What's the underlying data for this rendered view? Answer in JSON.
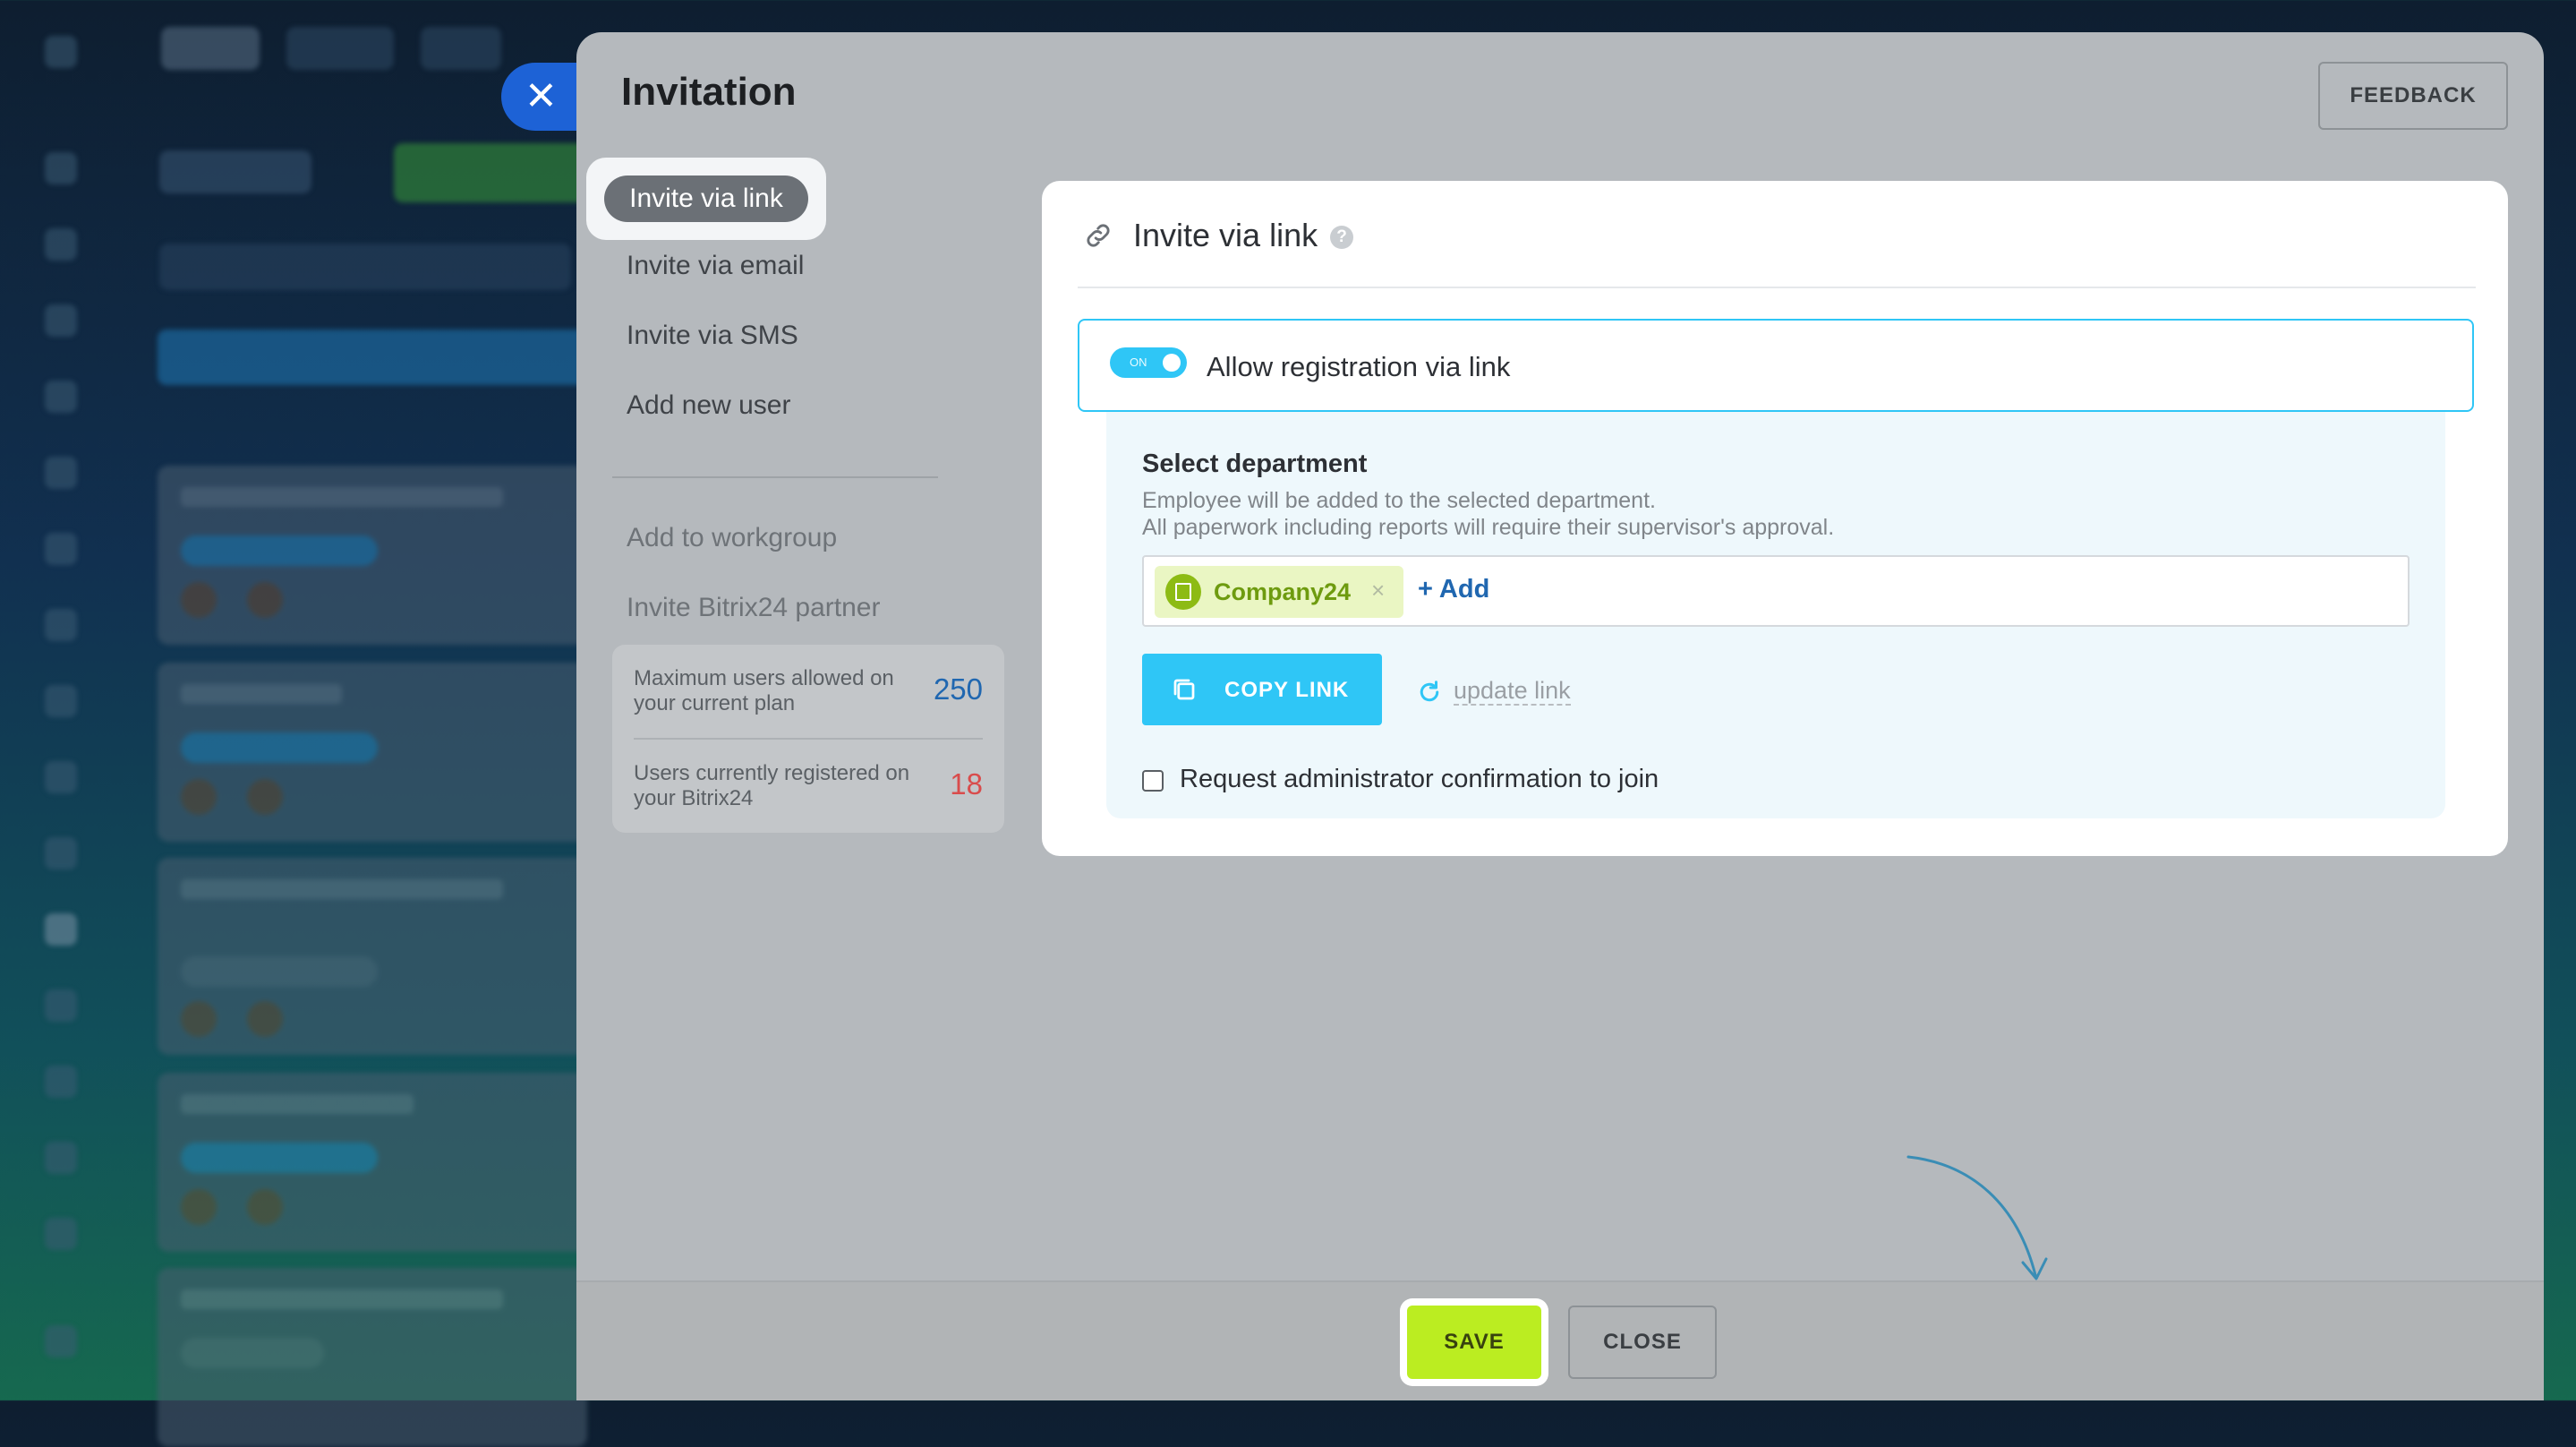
{
  "modal": {
    "title": "Invitation",
    "feedback_label": "FEEDBACK"
  },
  "nav": {
    "items": [
      {
        "label": "Invite via link",
        "active": true
      },
      {
        "label": "Invite via email"
      },
      {
        "label": "Invite via SMS"
      },
      {
        "label": "Add new user"
      }
    ],
    "extra_items": [
      {
        "label": "Add to workgroup"
      },
      {
        "label": "Invite Bitrix24 partner"
      }
    ]
  },
  "stats": {
    "max_users_label": "Maximum users allowed on your current plan",
    "max_users_value": "250",
    "registered_label": "Users currently registered on your Bitrix24",
    "registered_value": "18"
  },
  "panel": {
    "title": "Invite via link",
    "allow_label": "Allow registration via link",
    "toggle_state": "ON",
    "department": {
      "title": "Select department",
      "desc_line1": "Employee will be added to the selected department.",
      "desc_line2": "All paperwork including reports will require their supervisor's approval.",
      "selected": "Company24",
      "add_label": "+ Add"
    },
    "copy_label": "COPY LINK",
    "update_label": "update link",
    "confirm_label": "Request administrator confirmation to join"
  },
  "footer": {
    "save_label": "SAVE",
    "close_label": "CLOSE"
  },
  "colors": {
    "accent_blue": "#2fc6f6",
    "save_green": "#bbed21",
    "chip_green": "#8dbb14",
    "stat_blue": "#2067b0",
    "stat_red": "#d94c4c"
  }
}
